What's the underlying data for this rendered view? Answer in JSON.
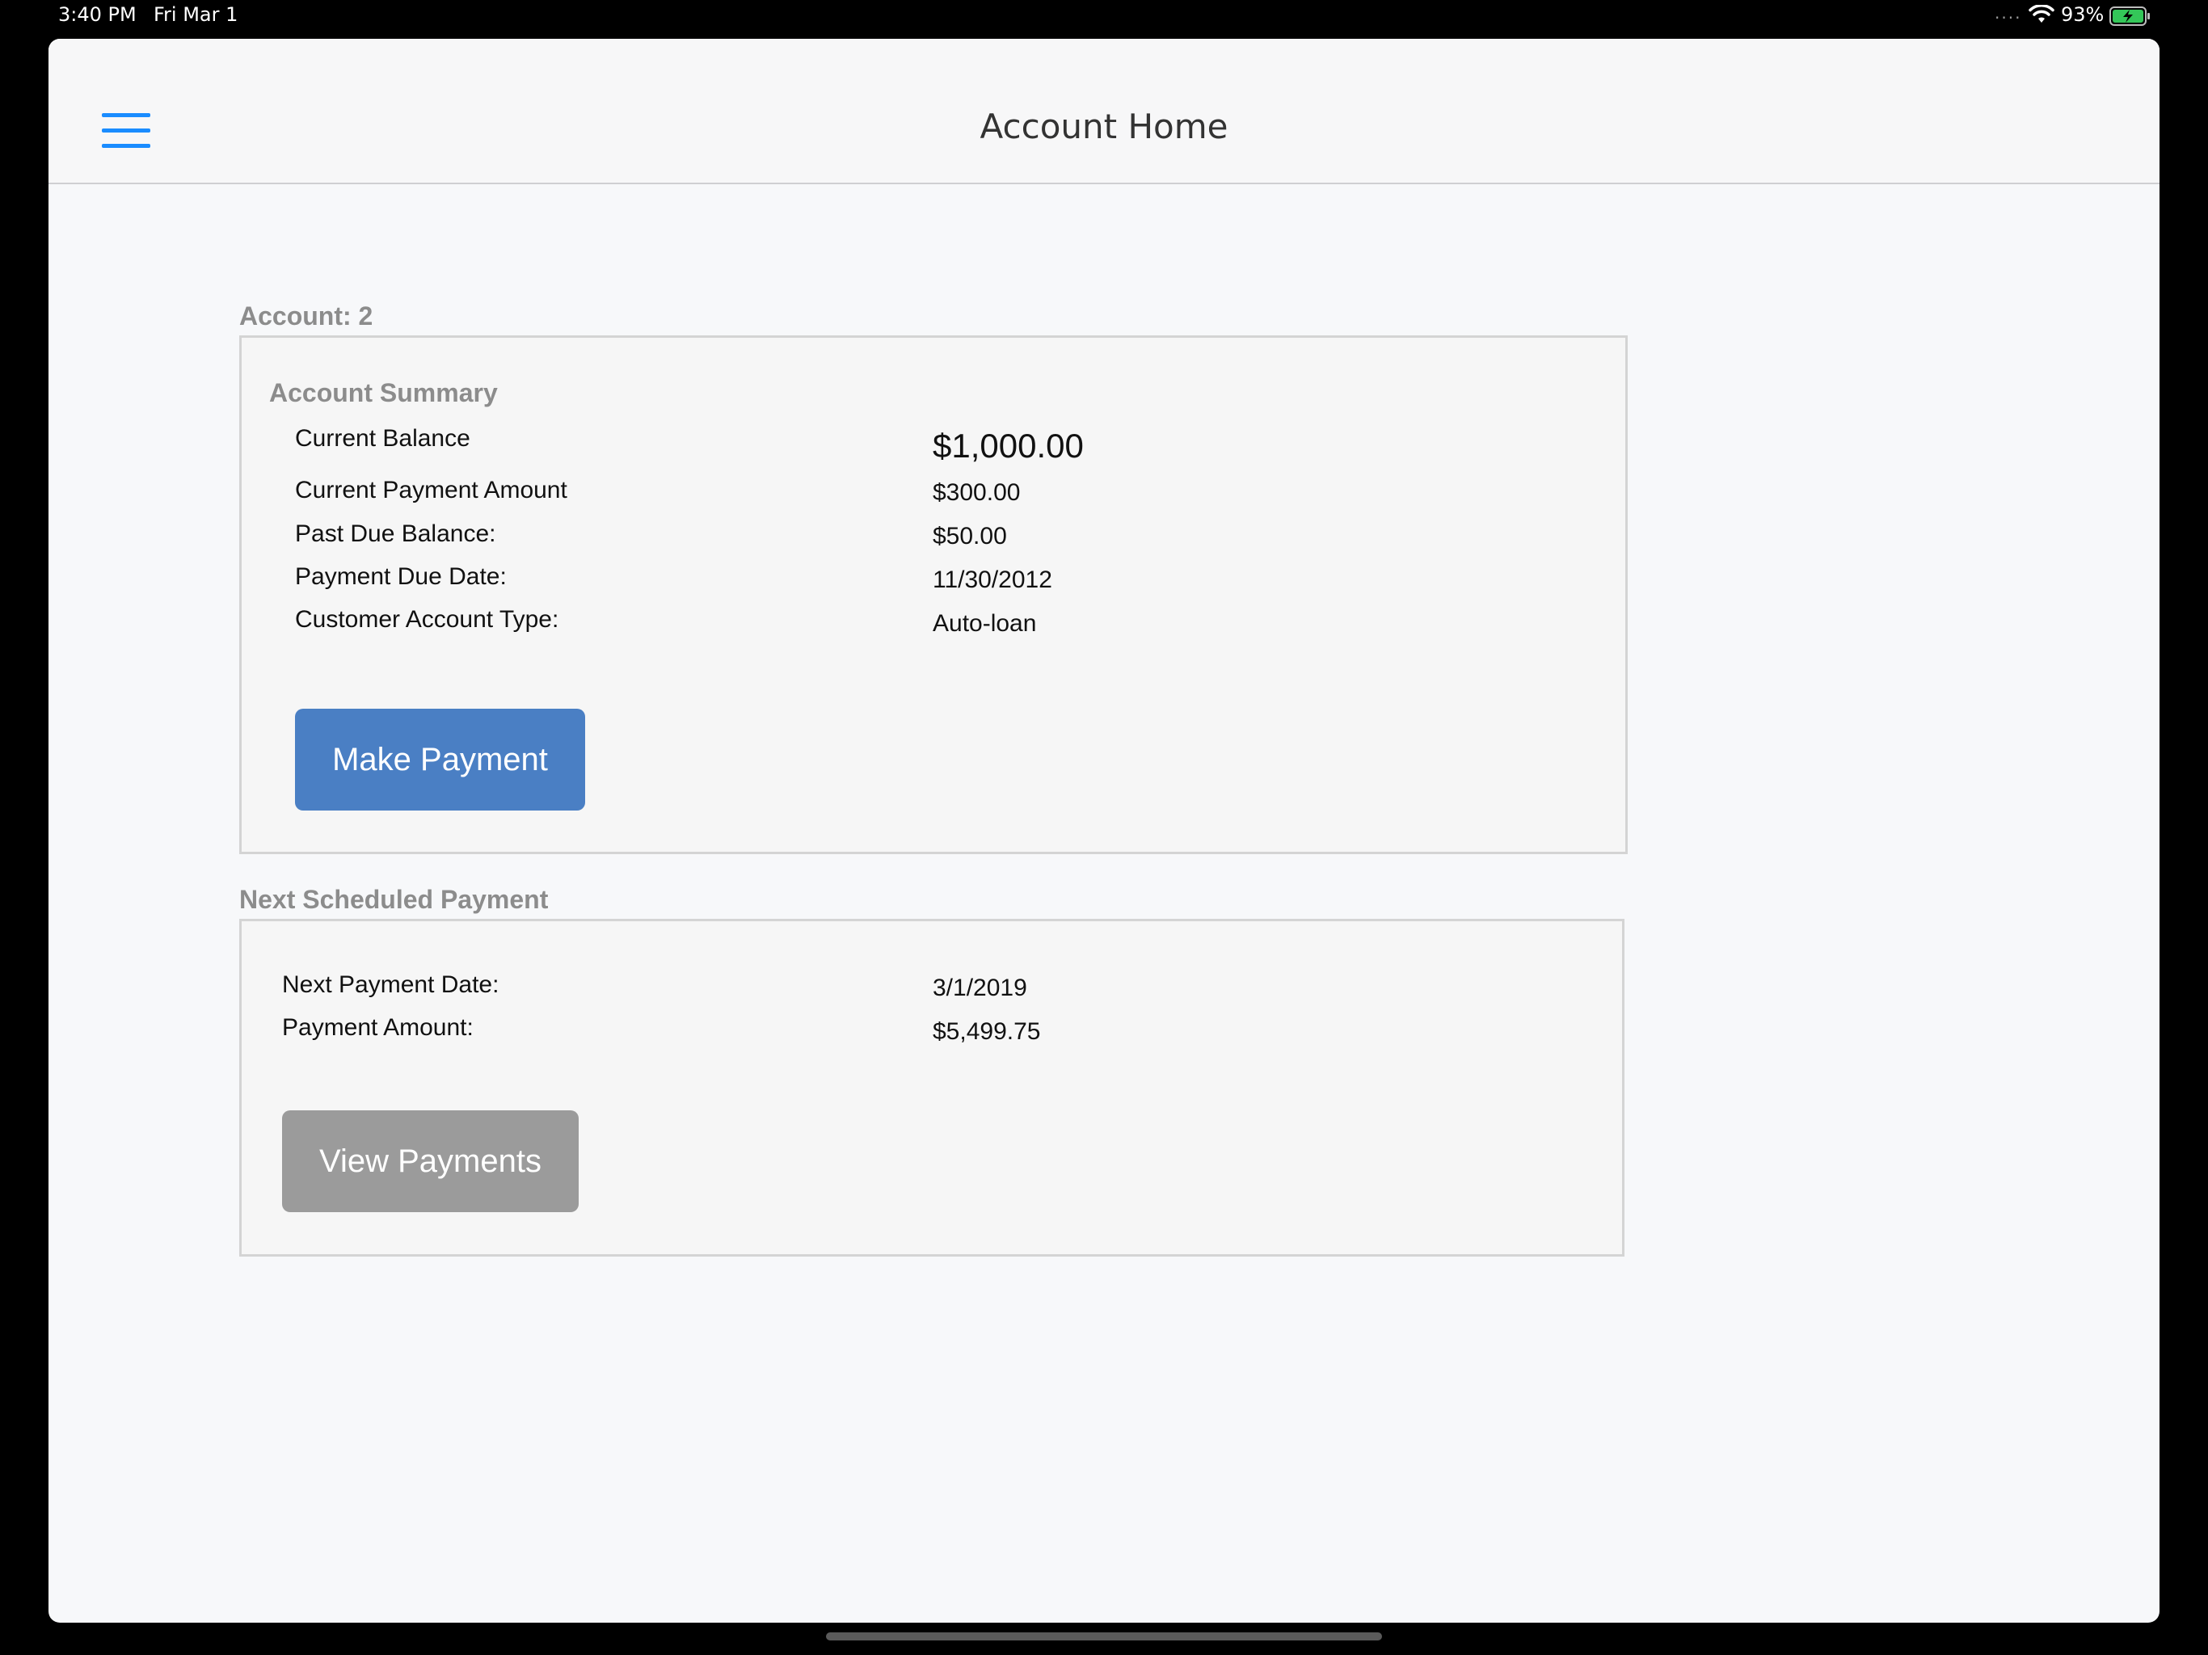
{
  "status_bar": {
    "time": "3:40 PM",
    "date": "Fri Mar 1",
    "dots": "....",
    "battery_percent": "93%",
    "wifi_icon": "wifi-icon",
    "battery_icon": "battery-charging-icon"
  },
  "nav": {
    "title": "Account Home",
    "menu_icon": "hamburger-menu-icon",
    "accent_color": "#1a8cff"
  },
  "account": {
    "label": "Account: 2",
    "summary": {
      "title": "Account Summary",
      "rows": [
        {
          "label": "Current Balance",
          "value": "$1,000.00"
        },
        {
          "label": "Current Payment Amount",
          "value": "$300.00"
        },
        {
          "label": "Past Due Balance:",
          "value": "$50.00"
        },
        {
          "label": "Payment Due Date:",
          "value": "11/30/2012"
        },
        {
          "label": "Customer Account Type:",
          "value": "Auto-loan"
        }
      ],
      "make_payment_label": "Make Payment",
      "make_payment_color": "#4a7fc4"
    }
  },
  "next_payment": {
    "label": "Next Scheduled Payment",
    "rows": [
      {
        "label": "Next Payment Date:",
        "value": "3/1/2019"
      },
      {
        "label": "Payment Amount:",
        "value": "$5,499.75"
      }
    ],
    "view_payments_label": "View Payments",
    "view_payments_color": "#9b9b9b"
  }
}
